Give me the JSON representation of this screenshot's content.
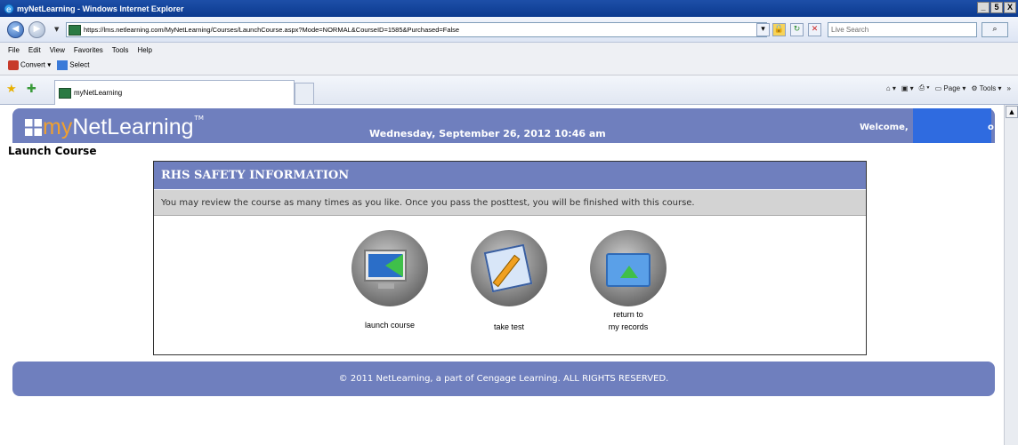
{
  "browser": {
    "window_title": "myNetLearning - Windows Internet Explorer",
    "window_buttons": [
      "_",
      "5",
      "X"
    ],
    "url": "https://lms.netlearning.com/MyNetLearning/Courses/LaunchCourse.aspx?Mode=NORMAL&CourseID=1585&Purchased=False",
    "search_placeholder": "Live Search",
    "menu": [
      "File",
      "Edit",
      "View",
      "Favorites",
      "Tools",
      "Help"
    ],
    "convert_label": "Convert",
    "select_label": "Select",
    "tab_label": "myNetLearning",
    "page_label": "Page",
    "tools_label": "Tools"
  },
  "page": {
    "logo_my": "my",
    "logo_netlearning": "NetLearning",
    "logo_tm": "TM",
    "datetime": "Wednesday, September 26, 2012 10:46 am",
    "welcome": "Welcome,",
    "welcome_tail": "o",
    "launch_title": "Launch Course",
    "course_title": "RHS SAFETY INFORMATION",
    "course_message": "You may review the course as many times as you like. Once you pass the posttest, you will be finished with this course.",
    "actions": {
      "launch": "launch course",
      "test": "take test",
      "return_line1": "return to",
      "return_line2": "my records"
    },
    "footer": "© 2011 NetLearning, a part of Cengage Learning. ALL RIGHTS RESERVED."
  },
  "colors": {
    "header_bg": "#6f7fbe",
    "logo_accent": "#f0a030",
    "redaction": "#2f6be0",
    "message_bg": "#d3d3d3"
  }
}
